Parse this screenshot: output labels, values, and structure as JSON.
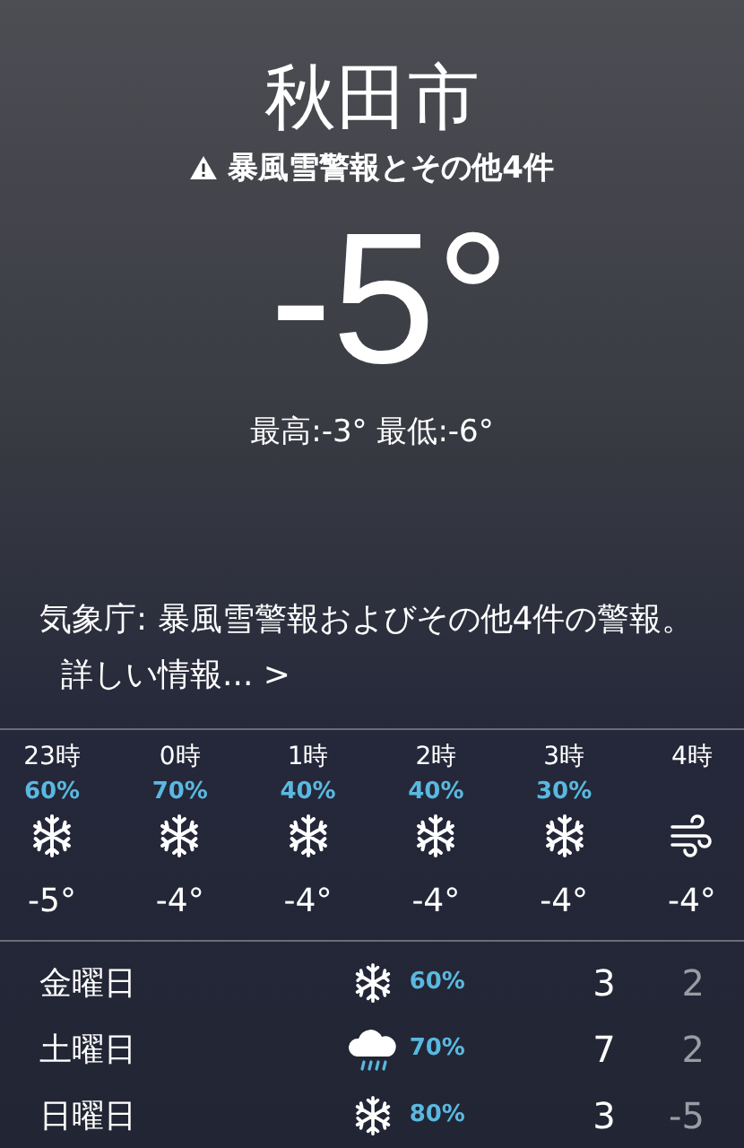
{
  "location": "秋田市",
  "alert_banner": "暴風雪警報とその他4件",
  "temperature": "-5°",
  "high_low": "最高:-3° 最低:-6°",
  "alert_text": "気象庁: 暴風雪警報およびその他4件の警報。",
  "more_link": "詳しい情報... >",
  "hourly": [
    {
      "time": "23時",
      "chance": "60%",
      "kind": "snow",
      "temp": "-5°"
    },
    {
      "time": "0時",
      "chance": "70%",
      "kind": "snow",
      "temp": "-4°"
    },
    {
      "time": "1時",
      "chance": "40%",
      "kind": "snow",
      "temp": "-4°"
    },
    {
      "time": "2時",
      "chance": "40%",
      "kind": "snow",
      "temp": "-4°"
    },
    {
      "time": "3時",
      "chance": "30%",
      "kind": "snow",
      "temp": "-4°"
    },
    {
      "time": "4時",
      "kind": "wind",
      "temp": "-4°"
    }
  ],
  "daily": [
    {
      "day": "金曜日",
      "kind": "snow",
      "chance": "60%",
      "high": "3",
      "low": "2"
    },
    {
      "day": "土曜日",
      "kind": "rain",
      "chance": "70%",
      "high": "7",
      "low": "2"
    },
    {
      "day": "日曜日",
      "kind": "snow",
      "chance": "80%",
      "high": "3",
      "low": "-5"
    }
  ]
}
